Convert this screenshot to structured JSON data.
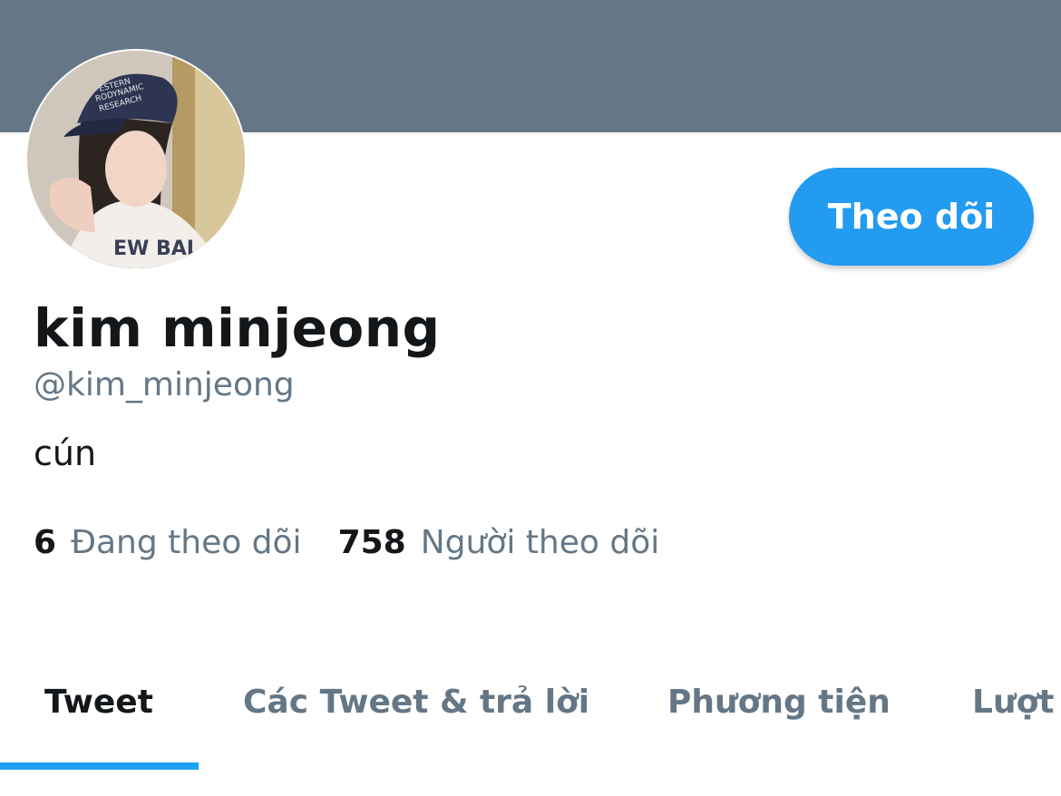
{
  "profile": {
    "follow_label": "Theo dõi",
    "display_name": "kim minjeong",
    "handle": "@kim_minjeong",
    "bio": "cún"
  },
  "stats": {
    "following_count": "6",
    "following_label": "Đang theo dõi",
    "followers_count": "758",
    "followers_label": "Người theo dõi"
  },
  "tabs": [
    {
      "label": "Tweet",
      "active": true
    },
    {
      "label": "Các Tweet & trả lời",
      "active": false
    },
    {
      "label": "Phương tiện",
      "active": false
    },
    {
      "label": "Lượt",
      "active": false
    }
  ],
  "colors": {
    "banner": "#657786",
    "accent": "#229bf0",
    "text_primary": "#14171a",
    "text_secondary": "#657786"
  }
}
